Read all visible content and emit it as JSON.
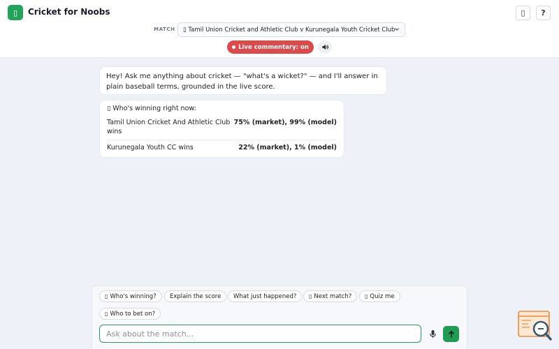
{
  "app": {
    "title": "Cricket for Noobs",
    "logo_glyph": "▯",
    "brand_color": "#22a35a"
  },
  "header": {
    "top_right_button_1": "▯",
    "help_button": "?",
    "match_label": "MATCH",
    "match_selected": "▯ Tamil Union Cricket and Athletic Club v Kurunegala Youth Cricket Club",
    "live_button_label": "Live commentary: on",
    "live_color": "#dc4b4b"
  },
  "chat": {
    "intro_message": "Hey! Ask me anything about cricket — \"what's a wicket?\" — and I'll answer in plain baseball terms, grounded in the live score.",
    "odds": {
      "heading": "▯ Who's winning right now:",
      "rows": [
        {
          "team": "Tamil Union Cricket And Athletic Club wins",
          "value": "75% (market), 99% (model)"
        },
        {
          "team": "Kurunegala Youth CC wins",
          "value": "22% (market), 1% (model)"
        }
      ]
    }
  },
  "composer": {
    "chips": [
      {
        "glyph": "▯",
        "label": "Who's winning?"
      },
      {
        "glyph": "",
        "label": "Explain the score"
      },
      {
        "glyph": "",
        "label": "What just happened?"
      },
      {
        "glyph": "▯",
        "label": "Next match?"
      },
      {
        "glyph": "▯",
        "label": "Quiz me"
      },
      {
        "glyph": "▯",
        "label": "Who to bet on?"
      }
    ],
    "input_placeholder": "Ask about the match...",
    "input_value": "",
    "accent_color": "#1f9d55"
  },
  "icons": {
    "mic": "microphone-icon",
    "send": "arrow-up-icon",
    "sound": "speaker-icon",
    "chevron": "chevron-down-icon"
  }
}
